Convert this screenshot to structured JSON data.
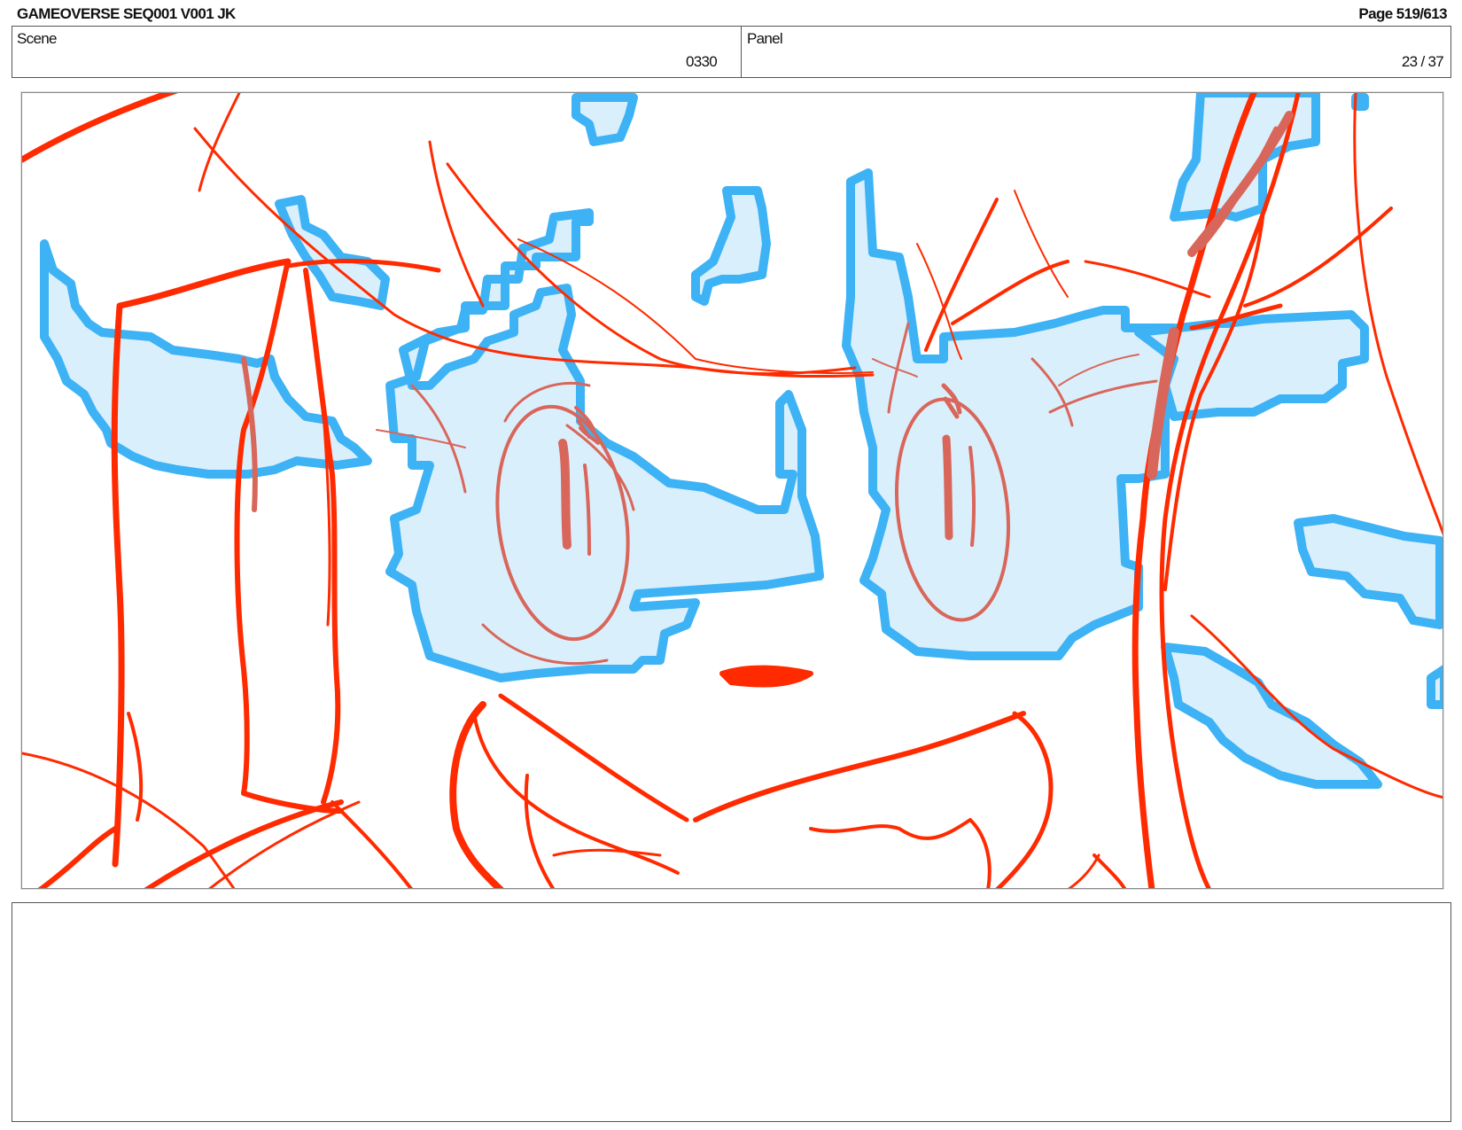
{
  "header": {
    "title": "GAMEOVERSE SEQ001 V001 JK",
    "page": "Page 519/613"
  },
  "info": {
    "scene_label": "Scene",
    "scene_value": "0330",
    "panel_label": "Panel",
    "panel_value": "23 / 37"
  },
  "artwork": {
    "line_color": "#ff2a00",
    "accent_line_color": "#d9665a",
    "highlight_stroke": "#3db2f5",
    "highlight_fill": "#d9effc"
  },
  "notes": {
    "text": ""
  }
}
